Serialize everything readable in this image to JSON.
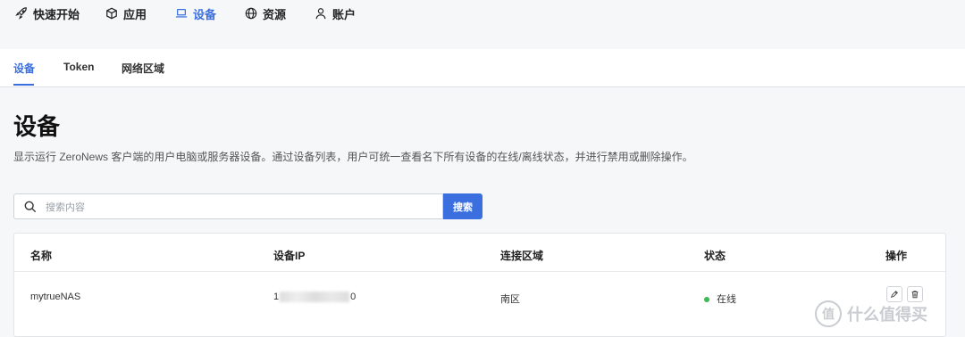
{
  "topnav": {
    "items": [
      {
        "label": "快速开始",
        "icon": "rocket-icon",
        "active": false
      },
      {
        "label": "应用",
        "icon": "box-icon",
        "active": false
      },
      {
        "label": "设备",
        "icon": "laptop-icon",
        "active": true
      },
      {
        "label": "资源",
        "icon": "globe-icon",
        "active": false
      },
      {
        "label": "账户",
        "icon": "user-icon",
        "active": false
      }
    ]
  },
  "subtabs": [
    {
      "label": "设备",
      "active": true
    },
    {
      "label": "Token",
      "active": false
    },
    {
      "label": "网络区域",
      "active": false
    }
  ],
  "page": {
    "title": "设备",
    "description": "显示运行 ZeroNews 客户端的用户电脑或服务器设备。通过设备列表，用户可统一查看名下所有设备的在线/离线状态，并进行禁用或删除操作。"
  },
  "search": {
    "placeholder": "搜索内容",
    "value": "",
    "button_label": "搜索"
  },
  "table": {
    "columns": [
      "名称",
      "设备IP",
      "连接区域",
      "状态",
      "操作"
    ],
    "rows": [
      {
        "name": "mytrueNAS",
        "ip_prefix": "1",
        "ip_suffix": "0",
        "region": "南区",
        "status": "在线"
      }
    ]
  },
  "watermark": {
    "text": "什么值得买",
    "symbol": "值"
  },
  "colors": {
    "accent": "#3b6fe0",
    "online": "#3cba54",
    "background": "#f6f7f9"
  }
}
